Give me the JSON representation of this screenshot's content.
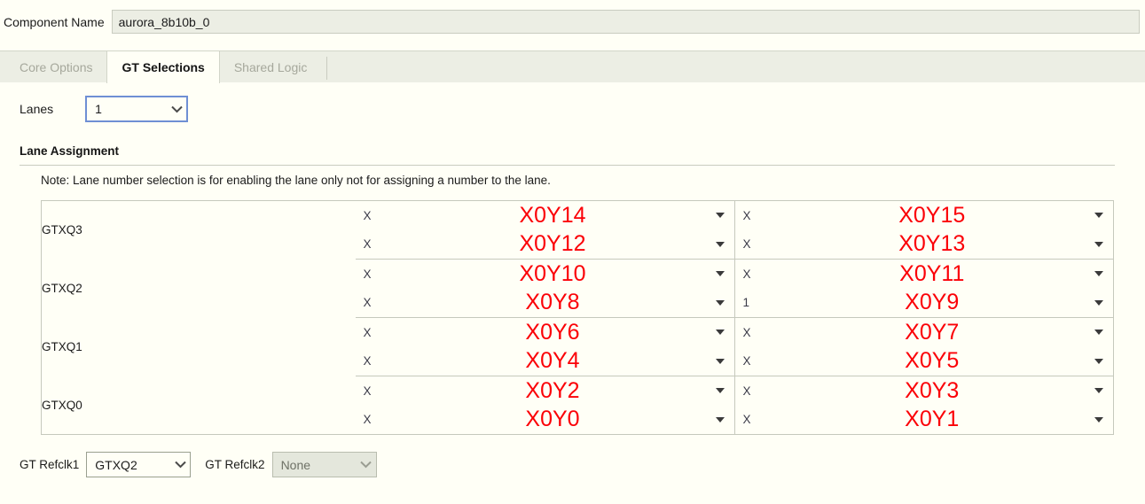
{
  "component": {
    "label": "Component Name",
    "value": "aurora_8b10b_0"
  },
  "tabs": [
    {
      "label": "Core Options",
      "active": false
    },
    {
      "label": "GT Selections",
      "active": true
    },
    {
      "label": "Shared Logic",
      "active": false
    }
  ],
  "lanes": {
    "label": "Lanes",
    "value": "1"
  },
  "lane_assignment": {
    "heading": "Lane Assignment",
    "note": "Note: Lane number selection is for enabling the lane only not for assigning a number to the lane."
  },
  "table": {
    "quads": [
      {
        "name": "GTXQ3",
        "rows": [
          {
            "left": {
              "mark": "X",
              "value": "X0Y14"
            },
            "right": {
              "mark": "X",
              "value": "X0Y15"
            }
          },
          {
            "left": {
              "mark": "X",
              "value": "X0Y12"
            },
            "right": {
              "mark": "X",
              "value": "X0Y13"
            }
          }
        ]
      },
      {
        "name": "GTXQ2",
        "rows": [
          {
            "left": {
              "mark": "X",
              "value": "X0Y10"
            },
            "right": {
              "mark": "X",
              "value": "X0Y11"
            }
          },
          {
            "left": {
              "mark": "X",
              "value": "X0Y8"
            },
            "right": {
              "mark": "1",
              "value": "X0Y9"
            }
          }
        ]
      },
      {
        "name": "GTXQ1",
        "rows": [
          {
            "left": {
              "mark": "X",
              "value": "X0Y6"
            },
            "right": {
              "mark": "X",
              "value": "X0Y7"
            }
          },
          {
            "left": {
              "mark": "X",
              "value": "X0Y4"
            },
            "right": {
              "mark": "X",
              "value": "X0Y5"
            }
          }
        ]
      },
      {
        "name": "GTXQ0",
        "rows": [
          {
            "left": {
              "mark": "X",
              "value": "X0Y2"
            },
            "right": {
              "mark": "X",
              "value": "X0Y3"
            }
          },
          {
            "left": {
              "mark": "X",
              "value": "X0Y0"
            },
            "right": {
              "mark": "X",
              "value": "X0Y1"
            }
          }
        ]
      }
    ]
  },
  "footer": {
    "refclk1": {
      "label": "GT Refclk1",
      "value": "GTXQ2"
    },
    "refclk2": {
      "label": "GT Refclk2",
      "value": "None"
    }
  },
  "colors": {
    "lane_value_red": "#fb0007",
    "page_background": "#fffff6",
    "panel_background": "#eceee4",
    "focus_blue": "#6f8fd4"
  }
}
